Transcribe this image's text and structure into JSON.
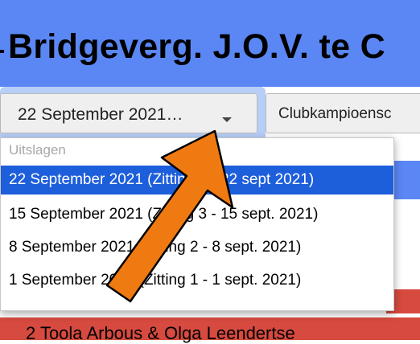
{
  "header": {
    "title": "Bridgeverg. J.O.V. te C"
  },
  "toolbar": {
    "select_value": "22 September 2021…",
    "club_button": "Clubkampioensc"
  },
  "dropdown": {
    "group_label": "Uitslagen",
    "options": [
      {
        "label": "22 September 2021 (Zitting 4 - 22 sept 2021)",
        "selected": true
      },
      {
        "label": "15 September 2021 (Zitting 3 - 15 sept. 2021)",
        "selected": false
      },
      {
        "label": "8 September 2021 (Zitting 2 - 8 sept. 2021)",
        "selected": false
      },
      {
        "label": "1 September 2021 (Zitting 1 - 1 sept. 2021)",
        "selected": false
      }
    ]
  },
  "background_row": {
    "text": "2   Toola Arbous & Olga Leendertse"
  },
  "colors": {
    "banner": "#5b87f5",
    "selected_option": "#1d5edb",
    "arrow": "#f07a12",
    "row_red": "#d64a3f"
  },
  "annotation": {
    "icon": "arrow-pointer"
  }
}
